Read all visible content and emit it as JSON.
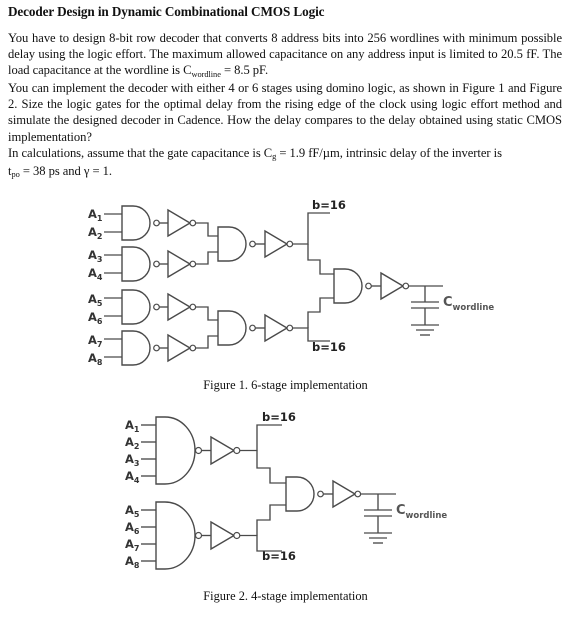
{
  "document": {
    "title": "Decoder Design in Dynamic Combinational CMOS Logic",
    "paragraphs": [
      {
        "id": "p1",
        "segments": [
          {
            "t": "You have to design 8-bit row decoder that converts 8 address bits into 256 wordlines with minimum possible delay using the logic effort. The maximum allowed capacitance on any address input is limited to 20.5 fF. The load capacitance at the wordline is C"
          },
          {
            "t": "wordline",
            "sub": true
          },
          {
            "t": " = 8.5 pF."
          }
        ]
      },
      {
        "id": "p2",
        "segments": [
          {
            "t": "You can implement the decoder with either 4 or 6 stages using domino logic, as shown in Figure 1 and Figure 2. Size the logic gates for the optimal delay from the rising edge of the clock using logic effort method and simulate the designed decoder in Cadence. How the delay compares to the delay obtained using static CMOS implementation?"
          }
        ]
      },
      {
        "id": "p3",
        "segments": [
          {
            "t": "In calculations, assume that the gate capacitance is C"
          },
          {
            "t": "g",
            "sub": true
          },
          {
            "t": " = 1.9 fF/µm, intrinsic delay of the inverter is"
          }
        ]
      },
      {
        "id": "p4",
        "segments": [
          {
            "t": "t"
          },
          {
            "t": "po",
            "sub": true
          },
          {
            "t": " = 38 ps and γ = 1."
          }
        ]
      }
    ]
  },
  "figure1": {
    "caption": "Figure 1. 6-stage implementation",
    "input_labels": [
      "A1",
      "A2",
      "A3",
      "A4",
      "A5",
      "A6",
      "A7",
      "A8"
    ],
    "input_base": "A",
    "input_subs": [
      "1",
      "2",
      "3",
      "4",
      "5",
      "6",
      "7",
      "8"
    ],
    "branch_labels": [
      "b=16",
      "b=16"
    ],
    "load_label_base": "C",
    "load_label_sub": "wordline",
    "stage_count": 6,
    "gates": [
      {
        "type": "nand2-icon",
        "stage": 1,
        "inputs": [
          "A1",
          "A2"
        ]
      },
      {
        "type": "inverter-icon",
        "stage": 2
      },
      {
        "type": "nand2-icon",
        "stage": 1,
        "inputs": [
          "A3",
          "A4"
        ]
      },
      {
        "type": "inverter-icon",
        "stage": 2
      },
      {
        "type": "nand2-icon",
        "stage": 3
      },
      {
        "type": "inverter-icon",
        "stage": 4
      },
      {
        "type": "nand2-icon",
        "stage": 1,
        "inputs": [
          "A5",
          "A6"
        ]
      },
      {
        "type": "inverter-icon",
        "stage": 2
      },
      {
        "type": "nand2-icon",
        "stage": 1,
        "inputs": [
          "A7",
          "A8"
        ]
      },
      {
        "type": "inverter-icon",
        "stage": 2
      },
      {
        "type": "nand2-icon",
        "stage": 3
      },
      {
        "type": "inverter-icon",
        "stage": 4
      },
      {
        "type": "nand2-icon",
        "stage": 5
      },
      {
        "type": "inverter-icon",
        "stage": 6
      }
    ]
  },
  "figure2": {
    "caption": "Figure 2. 4-stage implementation",
    "input_labels": [
      "A1",
      "A2",
      "A3",
      "A4",
      "A5",
      "A6",
      "A7",
      "A8"
    ],
    "input_base": "A",
    "input_subs": [
      "1",
      "2",
      "3",
      "4",
      "5",
      "6",
      "7",
      "8"
    ],
    "branch_labels": [
      "b=16",
      "b=16"
    ],
    "load_label_base": "C",
    "load_label_sub": "wordline",
    "stage_count": 4,
    "gates": [
      {
        "type": "nand4-icon",
        "stage": 1,
        "inputs": [
          "A1",
          "A2",
          "A3",
          "A4"
        ]
      },
      {
        "type": "inverter-icon",
        "stage": 2
      },
      {
        "type": "nand4-icon",
        "stage": 1,
        "inputs": [
          "A5",
          "A6",
          "A7",
          "A8"
        ]
      },
      {
        "type": "inverter-icon",
        "stage": 2
      },
      {
        "type": "nand2-icon",
        "stage": 3
      },
      {
        "type": "inverter-icon",
        "stage": 4
      }
    ]
  },
  "colors": {
    "page_background": "#ffffff",
    "text": "#111111",
    "wire": "#4a4a4a",
    "label": "#333333"
  }
}
